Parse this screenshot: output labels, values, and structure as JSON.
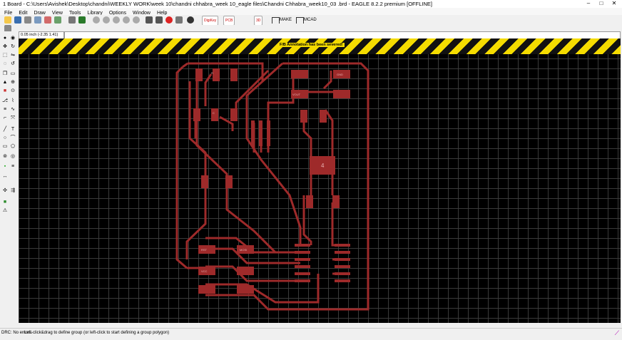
{
  "window": {
    "title": "1 Board - C:\\Users\\Avishek\\Desktop\\chandni\\WEEKLY WORK\\week 10\\chandni chhabra_week 10_eagle files\\Chandni Chhabra_week10_03 .brd - EAGLE 8.2.2 premium [OFFLINE]"
  },
  "menu": [
    "File",
    "Edit",
    "Draw",
    "View",
    "Tools",
    "Library",
    "Options",
    "Window",
    "Help"
  ],
  "toolbar": {
    "make_label": "MAKE",
    "mcad_label": "MCAD",
    "ext1": "DigiKey",
    "ext2": "PCB",
    "ext3": "3D"
  },
  "coord_display": "0.05 inch (-2.35 1.41)",
  "banner": {
    "message": "F/B Annotation has been severed!"
  },
  "board": {
    "parts": [
      {
        "name": "R",
        "label": "R"
      },
      {
        "name": "C",
        "label": "C"
      },
      {
        "name": "GND",
        "label": "GND"
      },
      {
        "name": "VCC",
        "label": "VCC"
      },
      {
        "name": "MOSI",
        "label": "MOSI"
      },
      {
        "name": "RST",
        "label": "RST"
      },
      {
        "name": "VOUT",
        "label": "VOUT"
      },
      {
        "name": "IC_pad_4",
        "label": "4"
      }
    ]
  },
  "status": {
    "drc": "DRC: No errors.",
    "hint": "Left-click&drag to define group (or left-click to start defining a group polygon)"
  }
}
